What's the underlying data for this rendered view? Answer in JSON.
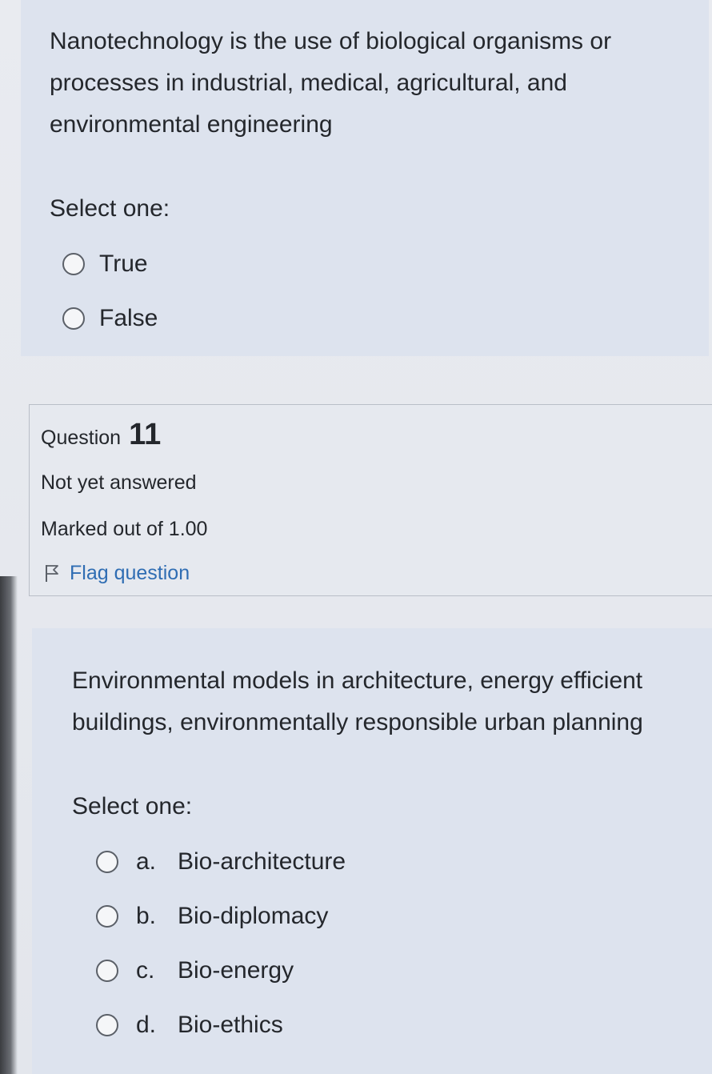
{
  "question10": {
    "text": "Nanotechnology is the use of biological organisms or processes in industrial, medical, agricultural, and environmental engineering",
    "prompt": "Select one:",
    "options": [
      {
        "label": "True"
      },
      {
        "label": "False"
      }
    ]
  },
  "question11": {
    "label": "Question",
    "number": "11",
    "state": "Not yet answered",
    "grade": "Marked out of 1.00",
    "flag_label": "Flag question",
    "flag_icon": "flag-icon",
    "text": "Environmental models in architecture, energy efficient buildings, environmentally responsible urban planning",
    "prompt": "Select one:",
    "options": [
      {
        "letter": "a.",
        "label": "Bio-architecture"
      },
      {
        "letter": "b.",
        "label": "Bio-diplomacy"
      },
      {
        "letter": "c.",
        "label": "Bio-energy"
      },
      {
        "letter": "d.",
        "label": "Bio-ethics"
      }
    ]
  },
  "colors": {
    "formulation_bg": "#dde3ee",
    "link": "#2f6db3",
    "text": "#24272c"
  }
}
